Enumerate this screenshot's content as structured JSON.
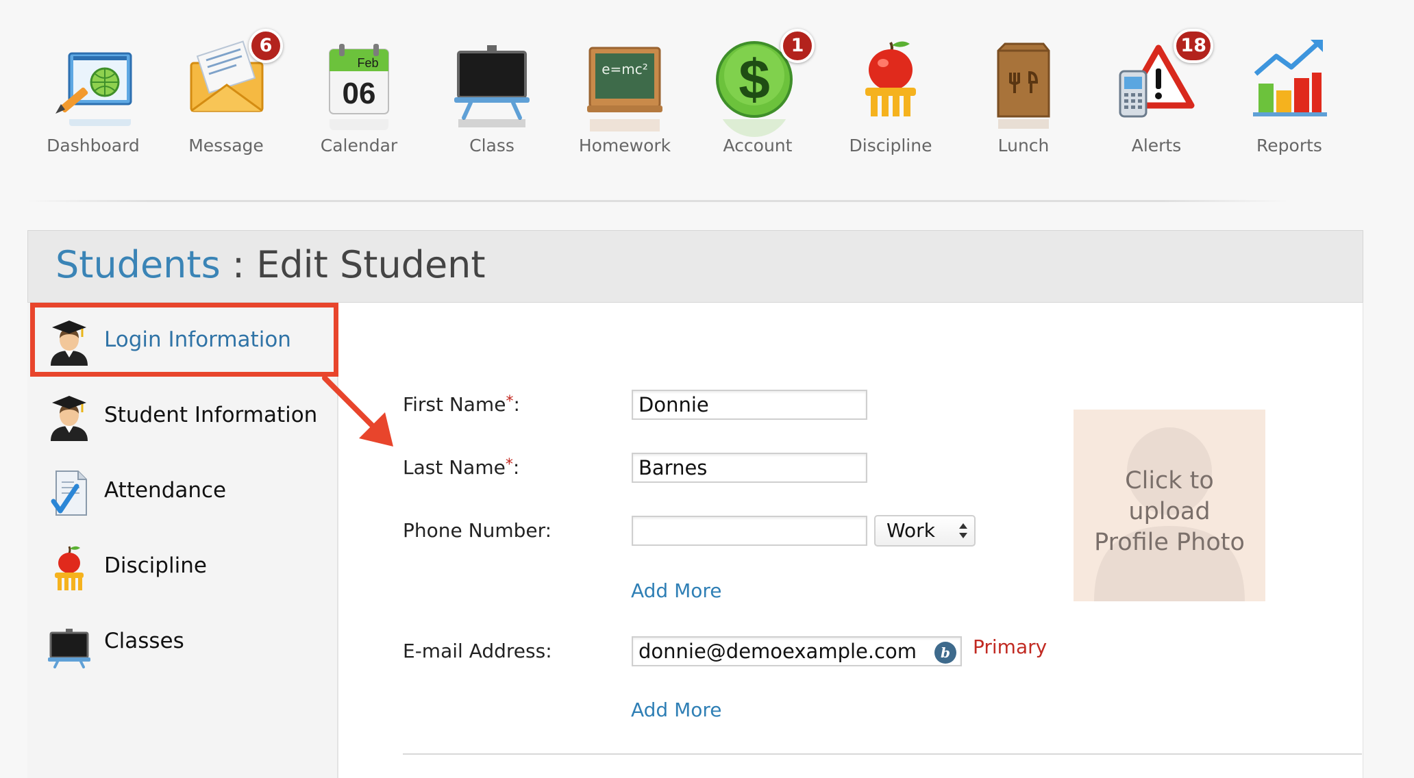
{
  "nav": {
    "items": [
      {
        "label": "Dashboard",
        "icon": "dashboard-icon"
      },
      {
        "label": "Message",
        "icon": "envelope-icon",
        "badge": "6"
      },
      {
        "label": "Calendar",
        "icon": "calendar-icon",
        "month": "Feb",
        "day": "06"
      },
      {
        "label": "Class",
        "icon": "chalkboard-icon"
      },
      {
        "label": "Homework",
        "icon": "blackboard-icon",
        "board_text": "e=mc²"
      },
      {
        "label": "Account",
        "icon": "dollar-icon",
        "badge": "1"
      },
      {
        "label": "Discipline",
        "icon": "apple-icon"
      },
      {
        "label": "Lunch",
        "icon": "lunch-bag-icon"
      },
      {
        "label": "Alerts",
        "icon": "alert-icon",
        "badge": "18"
      },
      {
        "label": "Reports",
        "icon": "bar-chart-icon"
      }
    ]
  },
  "header": {
    "breadcrumb": "Students",
    "separator": " : ",
    "title": "Edit Student"
  },
  "sidebar": {
    "items": [
      {
        "label": "Login Information",
        "icon": "graduate-icon",
        "active": true
      },
      {
        "label": "Student Information",
        "icon": "graduate-icon"
      },
      {
        "label": "Attendance",
        "icon": "checklist-icon"
      },
      {
        "label": "Discipline",
        "icon": "apple-icon"
      },
      {
        "label": "Classes",
        "icon": "chalkboard-icon"
      }
    ]
  },
  "form": {
    "first_name": {
      "label": "First Name",
      "required_mark": "*",
      "suffix": ":",
      "value": "Donnie"
    },
    "last_name": {
      "label": "Last Name",
      "required_mark": "*",
      "suffix": ":",
      "value": "Barnes"
    },
    "phone": {
      "label": "Phone Number:",
      "value": "",
      "type_selected": "Work"
    },
    "phone_add_more": "Add More",
    "email": {
      "label": "E-mail Address:",
      "value": "donnie@demoexample.com",
      "badge": "b",
      "tag": "Primary"
    },
    "email_add_more": "Add More",
    "photo": {
      "line1": "Click to",
      "line2": "upload",
      "line3": "Profile Photo"
    }
  },
  "colors": {
    "link": "#2f7fb5",
    "breadcrumb": "#3a84b6",
    "highlight": "#e8452c",
    "badge": "#b3231d",
    "primary_tag": "#c12a22"
  }
}
